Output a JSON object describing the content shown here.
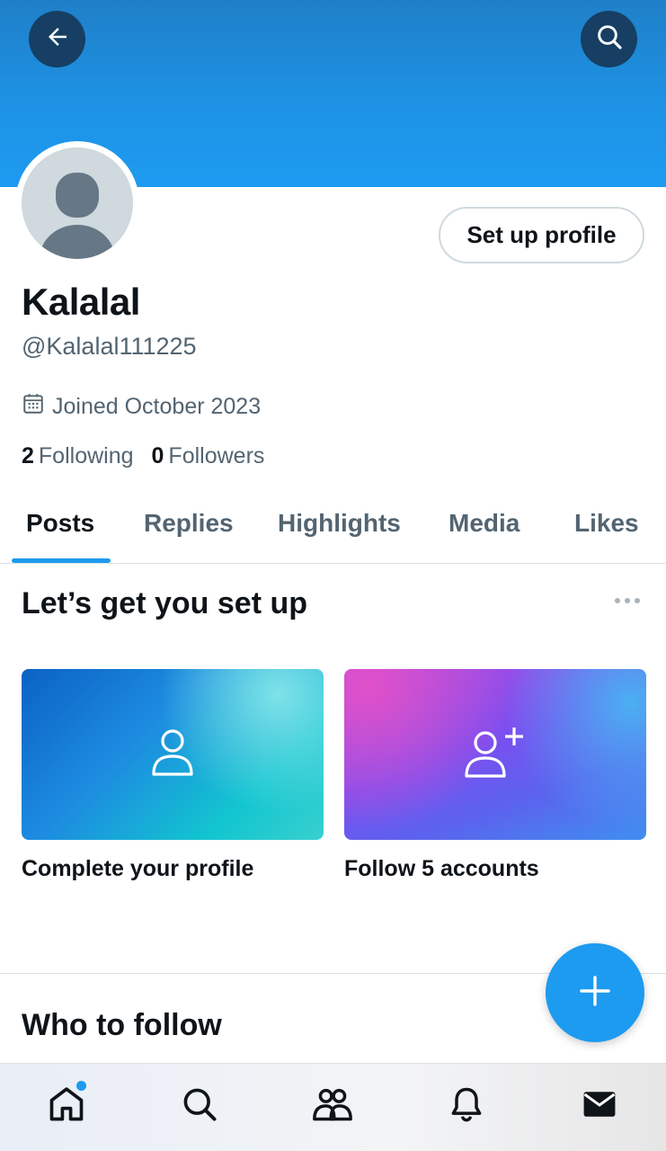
{
  "header": {
    "back_icon": "arrow-left-icon",
    "search_icon": "search-icon",
    "banner_color": "#1d9bf0"
  },
  "profile": {
    "display_name": "Kalalal",
    "handle": "@Kalalal111225",
    "joined": "Joined October 2023",
    "following_count": "2",
    "following_label": "Following",
    "followers_count": "0",
    "followers_label": "Followers",
    "setup_button_label": "Set up profile"
  },
  "tabs": [
    {
      "label": "Posts",
      "active": true
    },
    {
      "label": "Replies",
      "active": false
    },
    {
      "label": "Highlights",
      "active": false
    },
    {
      "label": "Media",
      "active": false
    },
    {
      "label": "Likes",
      "active": false
    }
  ],
  "setup_section": {
    "title": "Let’s get you set up",
    "cards": [
      {
        "label": "Complete your profile",
        "icon": "person-icon"
      },
      {
        "label": "Follow 5 accounts",
        "icon": "person-add-icon"
      }
    ]
  },
  "who_to_follow": {
    "title": "Who to follow"
  },
  "fab": {
    "icon": "plus-icon"
  },
  "bottom_nav": {
    "items": [
      "home-icon",
      "search-icon",
      "communities-icon",
      "notifications-icon",
      "messages-icon"
    ],
    "accent_color": "#1d9bf0"
  }
}
